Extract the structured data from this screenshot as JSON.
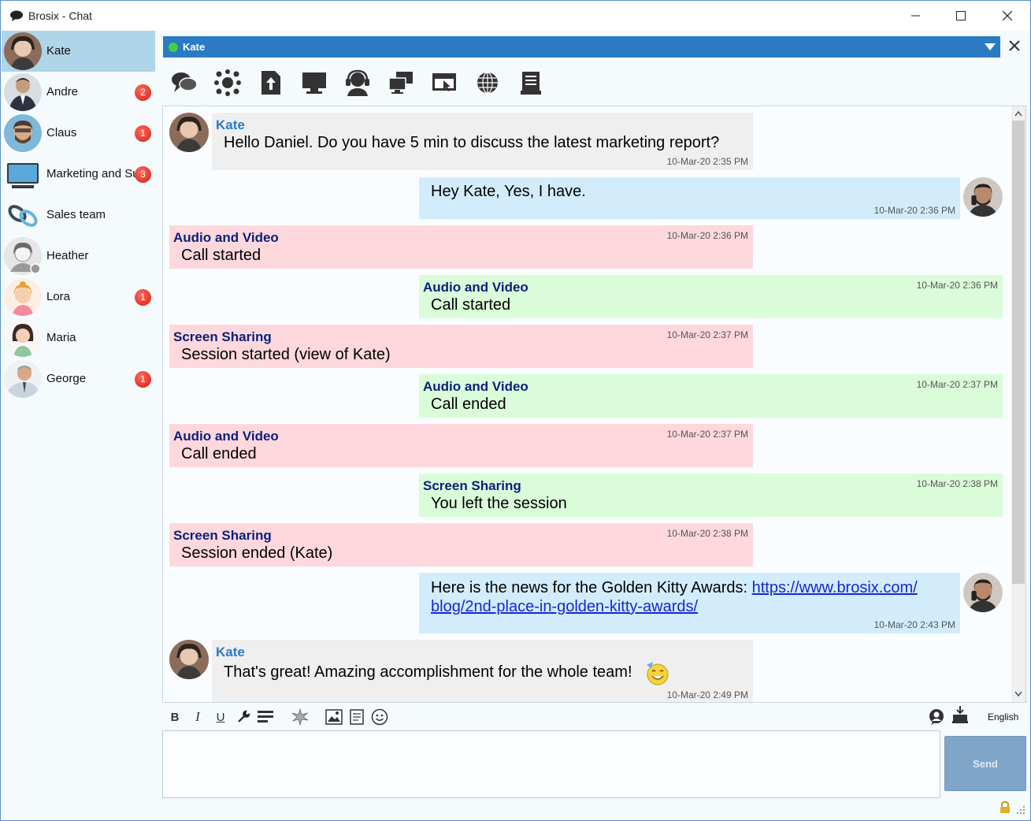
{
  "window": {
    "title": "Brosix - Chat"
  },
  "contacts": [
    {
      "name": "Kate",
      "badge": ""
    },
    {
      "name": "Andre",
      "badge": "2"
    },
    {
      "name": "Claus",
      "badge": "1"
    },
    {
      "name": "Marketing and Su",
      "badge": "3"
    },
    {
      "name": "Sales team",
      "badge": ""
    },
    {
      "name": "Heather",
      "badge": ""
    },
    {
      "name": "Lora",
      "badge": "1"
    },
    {
      "name": "Maria",
      "badge": ""
    },
    {
      "name": "George",
      "badge": "1"
    }
  ],
  "chat": {
    "header_name": "Kate",
    "status_color": "#3fd13f",
    "accent": "#2a7bc4"
  },
  "toolbar_icons": [
    "chat-bubbles-icon",
    "network-icon",
    "file-upload-icon",
    "monitor-icon",
    "headset-icon",
    "screens-icon",
    "remote-control-icon",
    "globe-icon",
    "document-icon"
  ],
  "messages": [
    {
      "sender": "Kate",
      "text": "Hello Daniel. Do you have 5 min to discuss the latest marketing report?",
      "time": "10-Mar-20 2:35 PM"
    },
    {
      "text": "Hey Kate, Yes, I have.",
      "time": "10-Mar-20 2:36 PM"
    },
    {
      "title": "Audio and Video",
      "text": "Call started",
      "time": "10-Mar-20 2:36 PM"
    },
    {
      "title": "Audio and Video",
      "text": "Call started",
      "time": "10-Mar-20 2:36 PM"
    },
    {
      "title": "Screen Sharing",
      "text": "Session started (view of Kate)",
      "time": "10-Mar-20 2:37 PM"
    },
    {
      "title": "Audio and Video",
      "text": "Call ended",
      "time": "10-Mar-20 2:37 PM"
    },
    {
      "title": "Audio and Video",
      "text": "Call ended",
      "time": "10-Mar-20 2:37 PM"
    },
    {
      "title": "Screen Sharing",
      "text": "You left the session",
      "time": "10-Mar-20 2:38 PM"
    },
    {
      "title": "Screen Sharing",
      "text": "Session ended (Kate)",
      "time": "10-Mar-20 2:38 PM"
    },
    {
      "text": "Here is the news for the Golden Kitty Awards:",
      "link_line1": "https://www.brosix.com/",
      "link_line2": "blog/2nd-place-in-golden-kitty-awards/",
      "time": "10-Mar-20 2:43 PM"
    },
    {
      "sender": "Kate",
      "text": "That's great! Amazing accomplishment for the whole team!",
      "time": "10-Mar-20 2:49 PM"
    }
  ],
  "format_bar": {
    "bold": "B",
    "italic": "I",
    "underline": "U",
    "language": "English"
  },
  "composer": {
    "placeholder": ""
  },
  "send_label": "Send"
}
